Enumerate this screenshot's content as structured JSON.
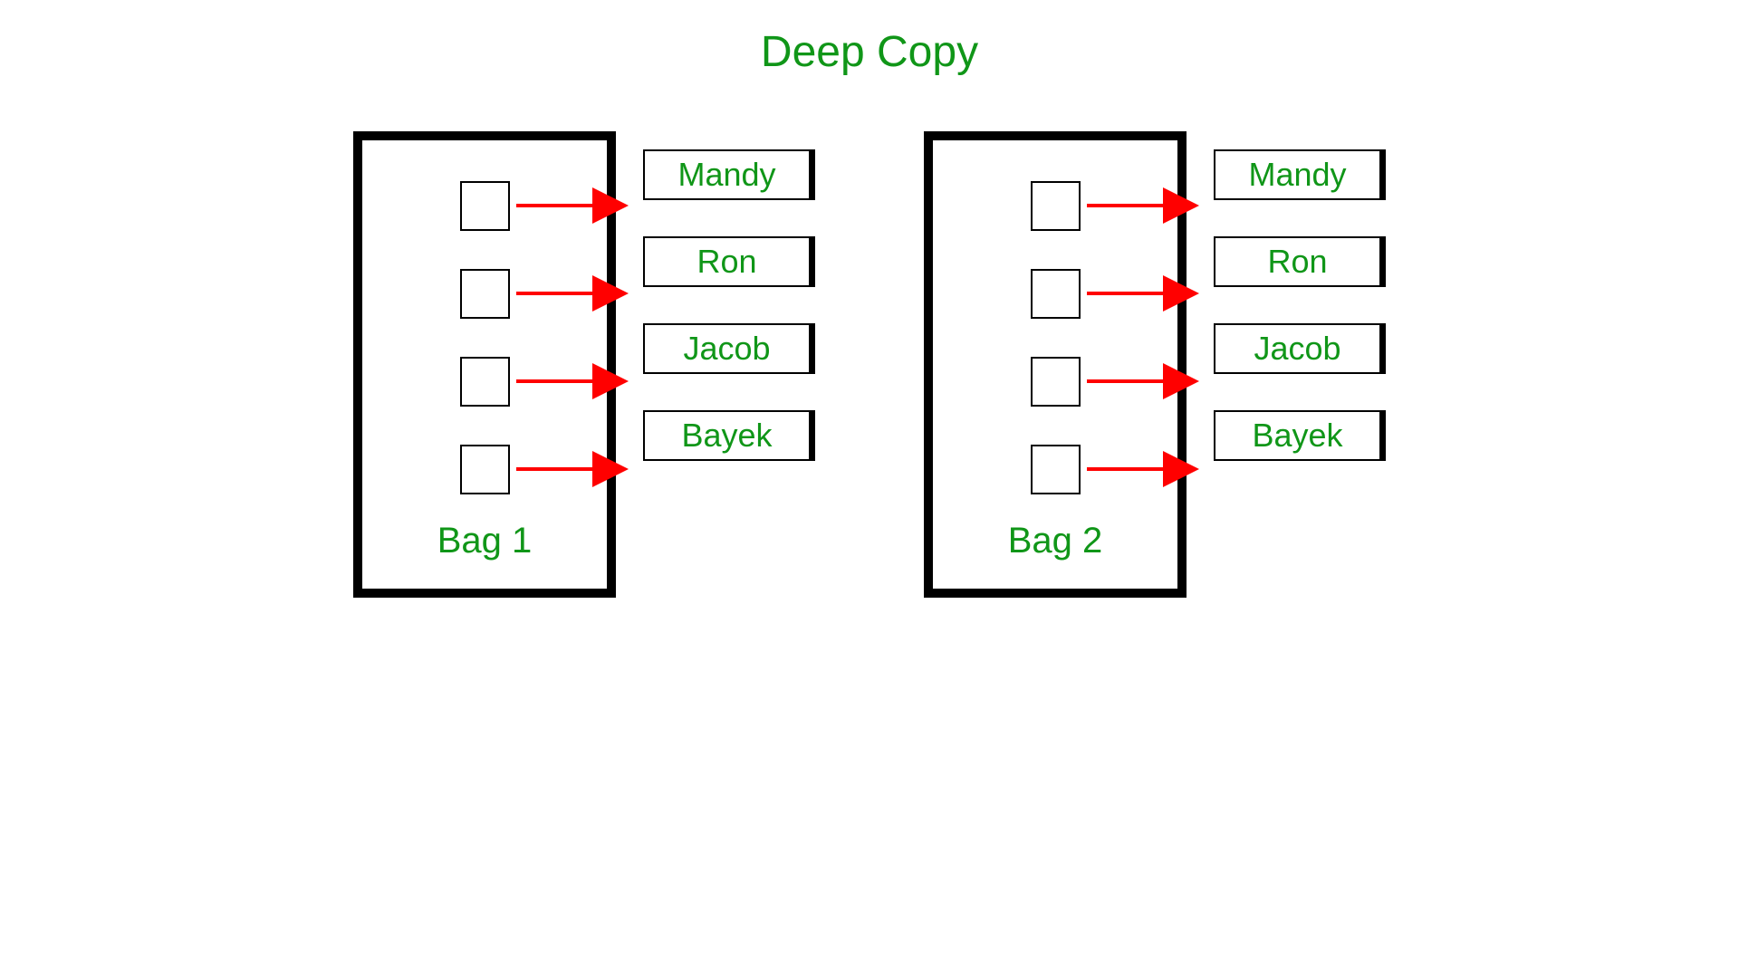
{
  "title": "Deep Copy",
  "bags": [
    {
      "label": "Bag 1",
      "values": [
        "Mandy",
        "Ron",
        "Jacob",
        "Bayek"
      ]
    },
    {
      "label": "Bag 2",
      "values": [
        "Mandy",
        "Ron",
        "Jacob",
        "Bayek"
      ]
    }
  ],
  "colors": {
    "text": "#109618",
    "arrow": "#ff0000",
    "border": "#000000"
  }
}
